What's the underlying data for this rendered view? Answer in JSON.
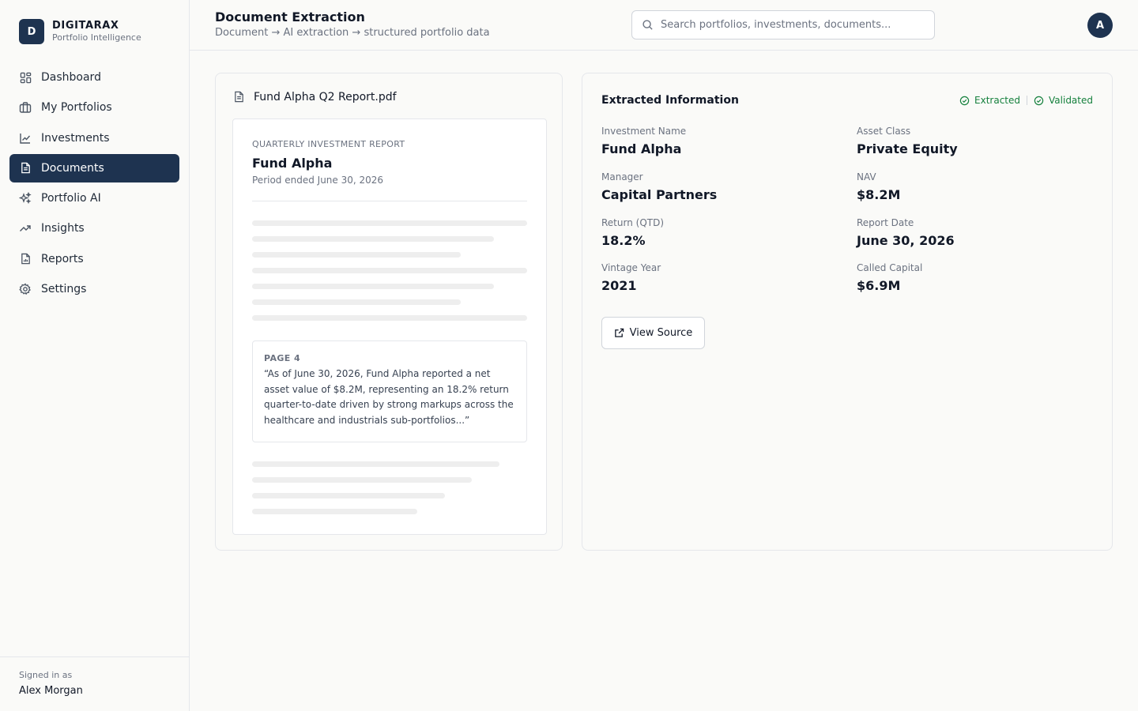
{
  "brand": {
    "logo_letter": "D",
    "name": "DIGITARAX",
    "tagline": "Portfolio Intelligence"
  },
  "sidebar": {
    "items": [
      {
        "label": "Dashboard",
        "icon": "dashboard-grid-icon",
        "active": false
      },
      {
        "label": "My Portfolios",
        "icon": "briefcase-icon",
        "active": false
      },
      {
        "label": "Investments",
        "icon": "line-chart-icon",
        "active": false
      },
      {
        "label": "Documents",
        "icon": "document-icon",
        "active": true
      },
      {
        "label": "Portfolio AI",
        "icon": "sparkles-icon",
        "active": false
      },
      {
        "label": "Insights",
        "icon": "trending-up-icon",
        "active": false
      },
      {
        "label": "Reports",
        "icon": "report-icon",
        "active": false
      },
      {
        "label": "Settings",
        "icon": "gear-icon",
        "active": false
      }
    ],
    "signed_in_label": "Signed in as",
    "user_name": "Alex Morgan"
  },
  "header": {
    "title": "Document Extraction",
    "subtitle": "Document → AI extraction → structured portfolio data",
    "search_placeholder": "Search portfolios, investments, documents...",
    "avatar_letter": "A"
  },
  "document": {
    "file_name": "Fund Alpha Q2 Report.pdf",
    "eyebrow": "QUARTERLY INVESTMENT REPORT",
    "fund_name": "Fund Alpha",
    "period": "Period ended June 30, 2026",
    "quote_page": "PAGE 4",
    "quote_text": "“As of June 30, 2026, Fund Alpha reported a net asset value of $8.2M, representing an 18.2% return quarter-to-date driven by strong markups across the healthcare and industrials sub-portfolios...”"
  },
  "extraction": {
    "title": "Extracted Information",
    "badges": [
      "Extracted",
      "Validated"
    ],
    "fields": [
      {
        "label": "Investment Name",
        "value": "Fund Alpha"
      },
      {
        "label": "Asset Class",
        "value": "Private Equity"
      },
      {
        "label": "Manager",
        "value": "Capital Partners"
      },
      {
        "label": "NAV",
        "value": "$8.2M"
      },
      {
        "label": "Return (QTD)",
        "value": "18.2%"
      },
      {
        "label": "Report Date",
        "value": "June 30, 2026"
      },
      {
        "label": "Vintage Year",
        "value": "2021"
      },
      {
        "label": "Called Capital",
        "value": "$6.9M"
      }
    ],
    "view_source_label": "View Source"
  },
  "colors": {
    "primary": "#1e3350",
    "success": "#15803d",
    "background": "#fafaf8"
  }
}
